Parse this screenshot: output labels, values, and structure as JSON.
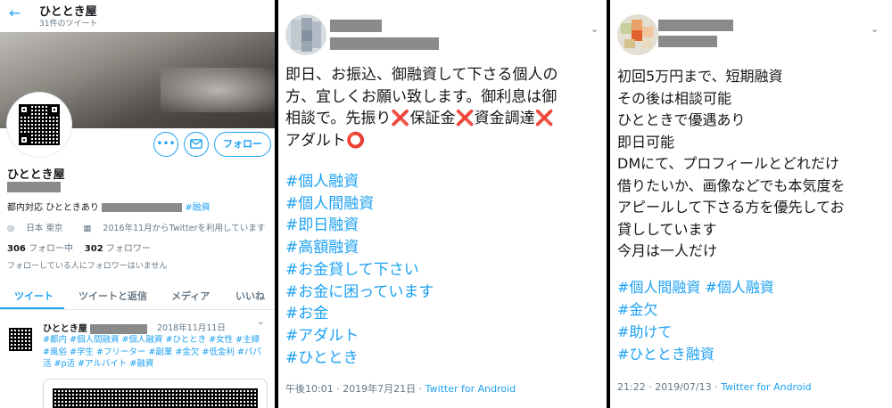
{
  "profile": {
    "title": "ひととき屋",
    "tweet_count": "31件のツイート",
    "name": "ひととき屋",
    "more_button": "•••",
    "mail_icon": "mail-icon",
    "follow_button": "フォロー",
    "bio_prefix": "都内対応 ひとときあり",
    "bio_tag": "#融資",
    "location": "日本 東京",
    "joined": "2016年11月からTwitterを利用しています",
    "following_count": "306",
    "following_label": "フォロー中",
    "followers_count": "302",
    "followers_label": "フォロワー",
    "note": "フォローしている人にフォロワーはいません",
    "tabs": [
      "ツイート",
      "ツイートと返信",
      "メディア",
      "いいね"
    ],
    "tweet": {
      "name": "ひととき屋",
      "date": "2018年11月11日",
      "tags": "#都内 #個人間融資 #個人融資 #ひととき #女性 #主婦 #風俗 #学生 #フリーター #副業 #金欠 #低金利 #パパ活 #p活 #アルバイト #融資"
    }
  },
  "tweet2": {
    "body_lines": [
      {
        "text": "即日、お振込、御融資して下さる個人の"
      },
      {
        "text": "方、宜しくお願い致します。御利息は御"
      },
      {
        "text": "相談で。先振り",
        "after": [
          {
            "mark": "❌",
            "text": "保証金"
          },
          {
            "mark": "❌",
            "text": "資金調達"
          },
          {
            "mark": "❌",
            "text": ""
          }
        ]
      },
      {
        "text": "アダルト",
        "after": [
          {
            "mark": "⭕",
            "text": ""
          }
        ]
      }
    ],
    "hashtags": [
      "#個人融資",
      "#個人間融資",
      "#即日融資",
      "#高額融資",
      "#お金貸して下さい",
      "#お金に困っています",
      "#お金",
      "#アダルト",
      "#ひととき"
    ],
    "time": "午後10:01 · 2019年7月21日 · ",
    "source": "Twitter for Android"
  },
  "tweet3": {
    "body_lines": [
      "初回5万円まで、短期融資",
      "その後は相談可能",
      "ひとときで優遇あり",
      "即日可能",
      "DMにて、プロフィールとどれだけ",
      "借りたいか、画像などでも本気度を",
      "アピールして下さる方を優先してお",
      "貸ししています",
      "今月は一人だけ"
    ],
    "hashtag_lines": [
      "#個人間融資 #個人融資",
      "#金欠",
      "#助けて",
      "#ひととき融資"
    ],
    "time": "21:22 · 2019/07/13 · ",
    "source": "Twitter for Android"
  }
}
